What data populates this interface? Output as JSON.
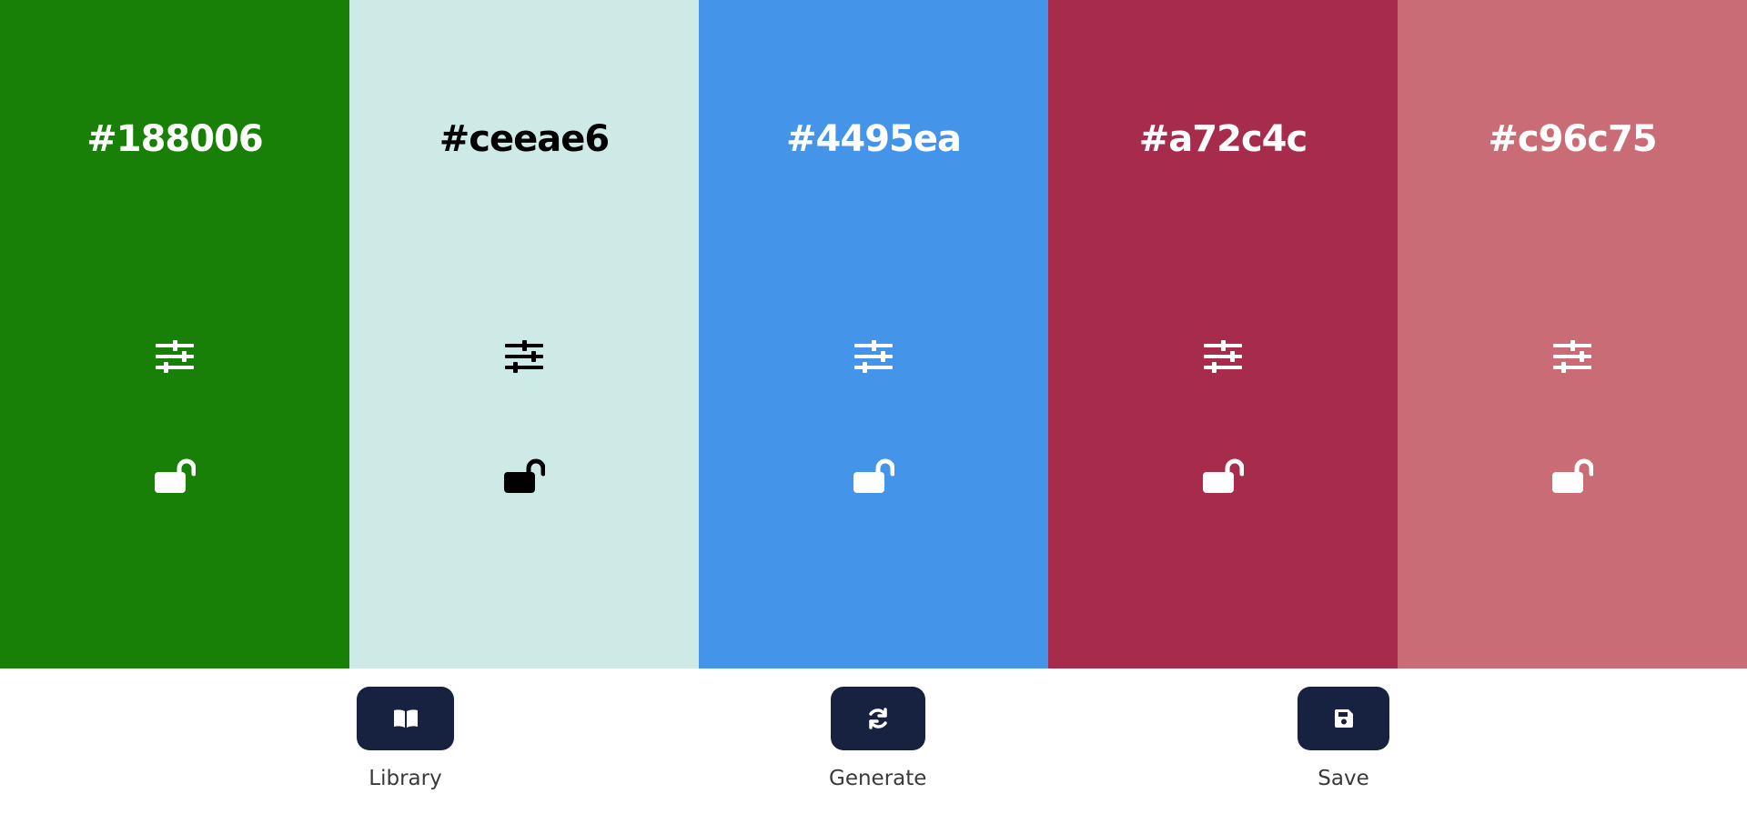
{
  "palette": {
    "colors": [
      {
        "hex": "#188006",
        "background": "#188006",
        "text_color": "#ffffff"
      },
      {
        "hex": "#ceeae6",
        "background": "#ceeae6",
        "text_color": "#000000"
      },
      {
        "hex": "#4495ea",
        "background": "#4495ea",
        "text_color": "#ffffff"
      },
      {
        "hex": "#a72c4c",
        "background": "#a72c4c",
        "text_color": "#ffffff"
      },
      {
        "hex": "#c96c75",
        "background": "#c96c75",
        "text_color": "#ffffff"
      }
    ],
    "adjust_icon": "sliders-icon",
    "lock_icon": "unlocked-padlock-icon"
  },
  "panel": {
    "button_color": "#172240",
    "library": {
      "label": "Library",
      "icon": "open-book-icon"
    },
    "generate": {
      "label": "Generate",
      "icon": "refresh-icon"
    },
    "save": {
      "label": "Save",
      "icon": "floppy-disk-icon"
    }
  }
}
